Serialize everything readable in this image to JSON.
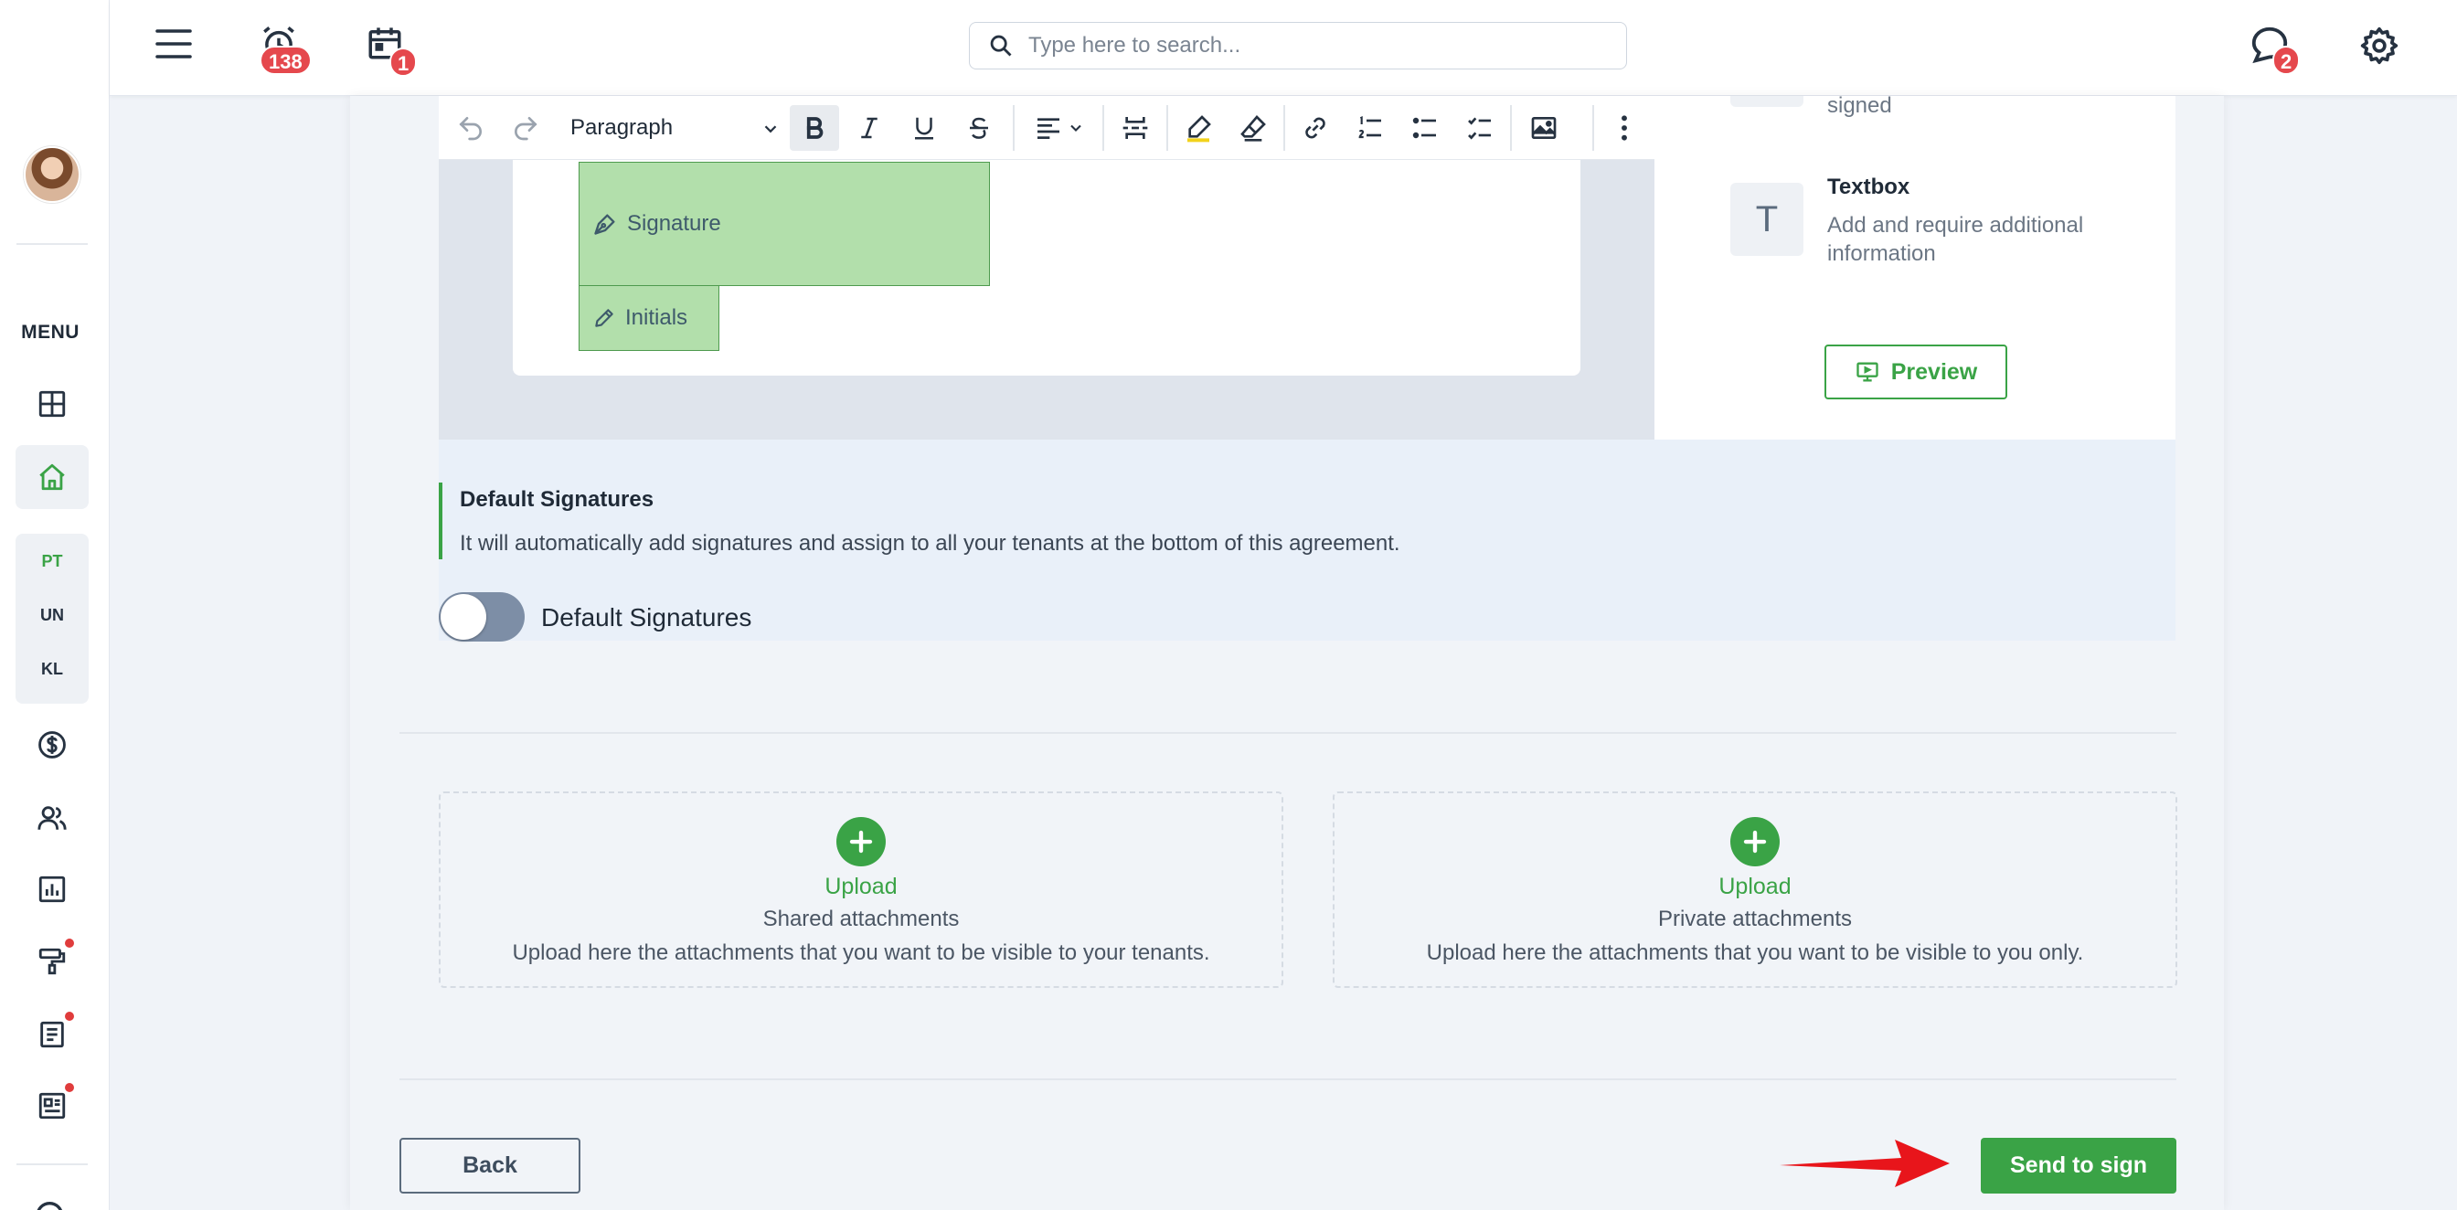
{
  "header": {
    "search_placeholder": "Type here to search...",
    "alarm_badge": "138",
    "calendar_badge": "1",
    "chat_badge": "2"
  },
  "sidebar": {
    "menu_label": "MENU",
    "tenants": [
      "PT",
      "UN",
      "KL"
    ]
  },
  "editor": {
    "paragraph_style": "Paragraph",
    "fields": {
      "signature": "Signature",
      "initials": "Initials"
    }
  },
  "right_panel": {
    "partial_text": "signed",
    "textbox_title": "Textbox",
    "textbox_desc": "Add and require additional information",
    "textbox_icon_letter": "T",
    "preview_label": "Preview"
  },
  "default_signatures": {
    "title": "Default Signatures",
    "description": "It will automatically add signatures and assign to all your tenants at the bottom of this agreement.",
    "toggle_label": "Default Signatures",
    "enabled": false
  },
  "attachments": [
    {
      "action": "Upload",
      "title": "Shared attachments",
      "description": "Upload here the attachments that you want to be visible to your tenants."
    },
    {
      "action": "Upload",
      "title": "Private attachments",
      "description": "Upload here the attachments that you want to be visible to you only."
    }
  ],
  "footer": {
    "back_label": "Back",
    "send_label": "Send to sign"
  },
  "colors": {
    "accent": "#3aa346",
    "badge": "#e5484d",
    "annotation_arrow": "#e8151b"
  }
}
